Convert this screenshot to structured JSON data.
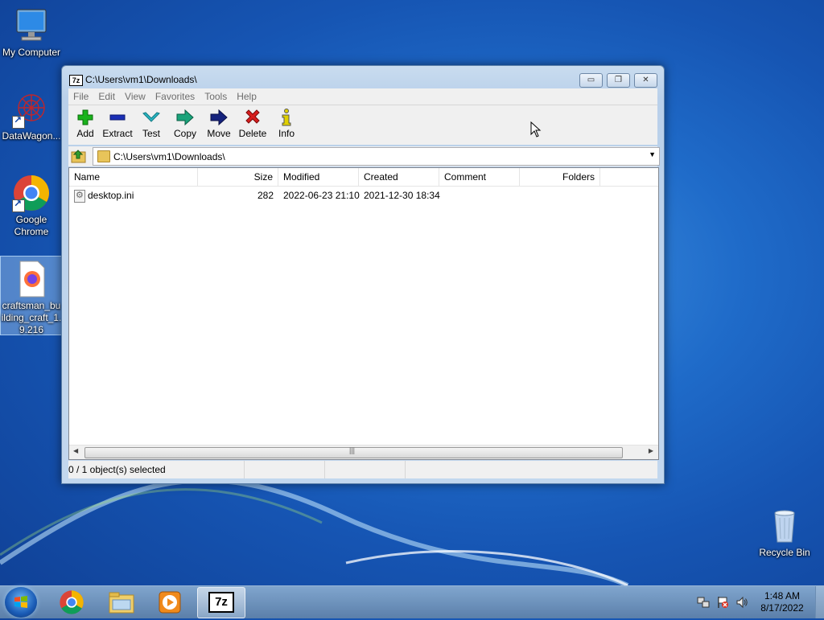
{
  "desktop": {
    "icons": [
      {
        "label": "My Computer"
      },
      {
        "label": "DataWagon..."
      },
      {
        "label_lines": [
          "Google",
          "Chrome"
        ]
      },
      {
        "label_lines": [
          "craftsman_bu",
          "ilding_craft_1.",
          "9.216"
        ]
      },
      {
        "label": "Recycle Bin"
      }
    ]
  },
  "window": {
    "title": "C:\\Users\\vm1\\Downloads\\",
    "app_icon_text": "7z",
    "caption_buttons": [
      "minimize",
      "restore",
      "close"
    ],
    "menu": [
      "File",
      "Edit",
      "View",
      "Favorites",
      "Tools",
      "Help"
    ],
    "toolbar": [
      {
        "label": "Add",
        "icon": "plus-icon",
        "color": "#19b31c"
      },
      {
        "label": "Extract",
        "icon": "minus-icon",
        "color": "#1b2fb5"
      },
      {
        "label": "Test",
        "icon": "check-icon",
        "color": "#2ab7c4"
      },
      {
        "label": "Copy",
        "icon": "copy-arrow-icon",
        "color": "#1aa37a"
      },
      {
        "label": "Move",
        "icon": "move-arrow-icon",
        "color": "#15227d"
      },
      {
        "label": "Delete",
        "icon": "delete-x-icon",
        "color": "#d81e1e"
      },
      {
        "label": "Info",
        "icon": "info-icon",
        "color": "#c7b800"
      }
    ],
    "address": "C:\\Users\\vm1\\Downloads\\",
    "columns": [
      "Name",
      "Size",
      "Modified",
      "Created",
      "Comment",
      "Folders"
    ],
    "files": [
      {
        "name": "desktop.ini",
        "size": "282",
        "modified": "2022-06-23 21:10",
        "created": "2021-12-30 18:34",
        "comment": "",
        "folders": ""
      }
    ],
    "status": "0 / 1 object(s) selected"
  },
  "taskbar": {
    "active_app_text": "7z",
    "clock_time": "1:48 AM",
    "clock_date": "8/17/2022"
  }
}
